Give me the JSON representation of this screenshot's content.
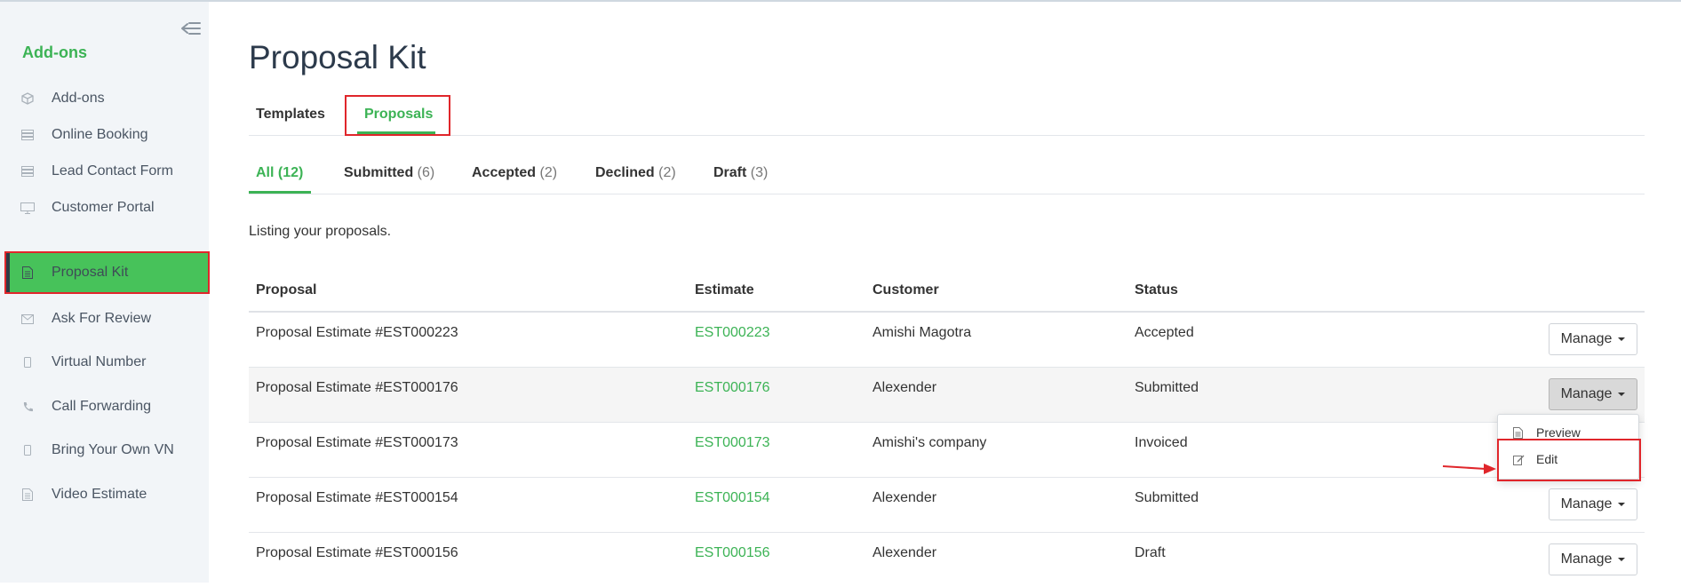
{
  "sidebar": {
    "title": "Add-ons",
    "items": [
      {
        "label": "Add-ons",
        "icon": "cube-icon"
      },
      {
        "label": "Online Booking",
        "icon": "server-icon"
      },
      {
        "label": "Lead Contact Form",
        "icon": "server-icon"
      },
      {
        "label": "Customer Portal",
        "icon": "monitor-icon"
      },
      {
        "label": "Proposal Kit",
        "icon": "document-icon"
      },
      {
        "label": "Ask For Review",
        "icon": "envelope-icon"
      },
      {
        "label": "Virtual Number",
        "icon": "mobile-icon"
      },
      {
        "label": "Call Forwarding",
        "icon": "phone-icon"
      },
      {
        "label": "Bring Your Own VN",
        "icon": "mobile-icon"
      },
      {
        "label": "Video Estimate",
        "icon": "document-icon"
      }
    ],
    "active_item": "Proposal Kit"
  },
  "page": {
    "title": "Proposal Kit",
    "tabs": [
      "Templates",
      "Proposals"
    ],
    "active_tab": "Proposals",
    "filters": [
      {
        "label": "All",
        "count": "(12)"
      },
      {
        "label": "Submitted",
        "count": "(6)"
      },
      {
        "label": "Accepted",
        "count": "(2)"
      },
      {
        "label": "Declined",
        "count": "(2)"
      },
      {
        "label": "Draft",
        "count": "(3)"
      }
    ],
    "active_filter": "All",
    "listing_text": "Listing your proposals."
  },
  "table": {
    "columns": [
      "Proposal",
      "Estimate",
      "Customer",
      "Status"
    ],
    "rows": [
      {
        "proposal": "Proposal Estimate #EST000223",
        "estimate": "EST000223",
        "customer": "Amishi Magotra",
        "status": "Accepted"
      },
      {
        "proposal": "Proposal Estimate #EST000176",
        "estimate": "EST000176",
        "customer": "Alexender",
        "status": "Submitted"
      },
      {
        "proposal": "Proposal Estimate #EST000173",
        "estimate": "EST000173",
        "customer": "Amishi's company",
        "status": "Invoiced"
      },
      {
        "proposal": "Proposal Estimate #EST000154",
        "estimate": "EST000154",
        "customer": "Alexender",
        "status": "Submitted"
      },
      {
        "proposal": "Proposal Estimate #EST000156",
        "estimate": "EST000156",
        "customer": "Alexender",
        "status": "Draft"
      }
    ],
    "manage_label": "Manage"
  },
  "dropdown": {
    "items": [
      {
        "label": "Preview",
        "icon": "document-icon"
      },
      {
        "label": "Edit",
        "icon": "edit-icon"
      }
    ]
  },
  "colors": {
    "accent": "#3cb355",
    "active_item_bg": "#47c25a",
    "highlight_box": "#e0262b"
  }
}
